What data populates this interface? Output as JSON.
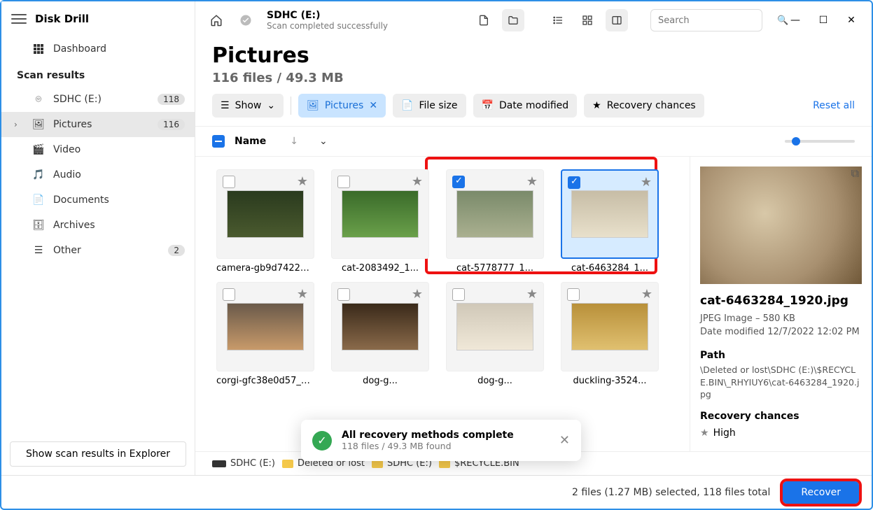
{
  "app_title": "Disk Drill",
  "sidebar": {
    "dashboard": "Dashboard",
    "scan_results_heading": "Scan results",
    "items": [
      {
        "label": "SDHC (E:)",
        "badge": "118"
      },
      {
        "label": "Pictures",
        "badge": "116",
        "selected": true
      },
      {
        "label": "Video"
      },
      {
        "label": "Audio"
      },
      {
        "label": "Documents"
      },
      {
        "label": "Archives"
      },
      {
        "label": "Other",
        "badge": "2"
      }
    ],
    "explorer_btn": "Show scan results in Explorer"
  },
  "topbar": {
    "drive": "SDHC (E:)",
    "status": "Scan completed successfully",
    "search_placeholder": "Search"
  },
  "page": {
    "title": "Pictures",
    "subtitle": "116 files / 49.3 MB"
  },
  "filters": {
    "show": "Show",
    "pictures": "Pictures",
    "filesize": "File size",
    "date": "Date modified",
    "recovery": "Recovery chances",
    "reset": "Reset all"
  },
  "columns": {
    "name": "Name"
  },
  "thumbs": [
    {
      "file": "camera-gb9d7422e2_1...",
      "cls": "th-camera",
      "checked": false,
      "sel": false
    },
    {
      "file": "cat-2083492_1...",
      "cls": "th-cat1",
      "checked": false,
      "sel": false
    },
    {
      "file": "cat-5778777_1...",
      "cls": "th-cat2",
      "checked": true,
      "sel": false
    },
    {
      "file": "cat-6463284_1...",
      "cls": "th-cat3",
      "checked": true,
      "sel": true
    },
    {
      "file": "corgi-gfc38e0d57_1...",
      "cls": "th-corgi",
      "checked": false,
      "sel": false
    },
    {
      "file": "dog-g...",
      "cls": "th-dog1",
      "checked": false,
      "sel": false
    },
    {
      "file": "dog-g...",
      "cls": "th-dog2",
      "checked": false,
      "sel": false
    },
    {
      "file": "duckling-3524...",
      "cls": "th-duck",
      "checked": false,
      "sel": false
    }
  ],
  "preview": {
    "filename": "cat-6463284_1920.jpg",
    "type": "JPEG Image – 580 KB",
    "modified": "Date modified 12/7/2022 12:02 PM",
    "path_h": "Path",
    "path": "\\Deleted or lost\\SDHC (E:)\\$RECYCLE.BIN\\_RHYIUY6\\cat-6463284_1920.jpg",
    "chances_h": "Recovery chances",
    "chances": "High"
  },
  "crumbs": [
    "SDHC (E:)",
    "Deleted or lost",
    "SDHC (E:)",
    "$RECYCLE.BIN"
  ],
  "toast": {
    "title": "All recovery methods complete",
    "sub": "118 files / 49.3 MB found"
  },
  "footer": {
    "status": "2 files (1.27 MB) selected, 118 files total",
    "recover": "Recover"
  }
}
